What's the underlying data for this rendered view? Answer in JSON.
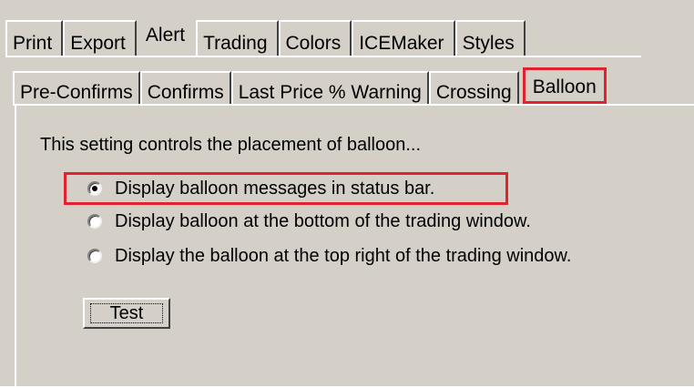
{
  "tabs": [
    {
      "label": "Print",
      "active": false
    },
    {
      "label": "Export",
      "active": false
    },
    {
      "label": "Alert",
      "active": true
    },
    {
      "label": "Trading",
      "active": false
    },
    {
      "label": "Colors",
      "active": false
    },
    {
      "label": "ICEMaker",
      "active": false
    },
    {
      "label": "Styles",
      "active": false
    }
  ],
  "subtabs": [
    {
      "label": "Pre-Confirms",
      "active": false
    },
    {
      "label": "Confirms",
      "active": false
    },
    {
      "label": "Last Price % Warning",
      "active": false
    },
    {
      "label": "Crossing",
      "active": false
    },
    {
      "label": "Balloon",
      "active": true
    }
  ],
  "panel": {
    "description": "This setting controls the placement of balloon...",
    "options": [
      {
        "label": "Display balloon messages in status bar.",
        "selected": true
      },
      {
        "label": "Display balloon at the bottom of the trading window.",
        "selected": false
      },
      {
        "label": "Display the balloon at the top right of the trading window.",
        "selected": false
      }
    ],
    "test_button": "Test"
  },
  "colors": {
    "dialog_bg": "#d4d0c8",
    "highlight": "#e0232f"
  }
}
